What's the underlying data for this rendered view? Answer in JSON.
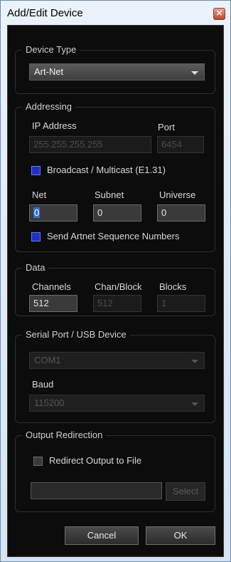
{
  "window": {
    "title": "Add/Edit Device",
    "close_glyph": "✕"
  },
  "device_type": {
    "legend": "Device Type",
    "selected": "Art-Net"
  },
  "addressing": {
    "legend": "Addressing",
    "ip_label": "IP Address",
    "ip_value": "255.255.255.255",
    "port_label": "Port",
    "port_value": "6454",
    "broadcast_label": "Broadcast / Multicast (E1.31)",
    "broadcast_checked": true,
    "net_label": "Net",
    "net_value": "0",
    "subnet_label": "Subnet",
    "subnet_value": "0",
    "universe_label": "Universe",
    "universe_value": "0",
    "sequence_label": "Send Artnet Sequence Numbers",
    "sequence_checked": true
  },
  "data_group": {
    "legend": "Data",
    "channels_label": "Channels",
    "channels_value": "512",
    "chan_block_label": "Chan/Block",
    "chan_block_value": "512",
    "blocks_label": "Blocks",
    "blocks_value": "1"
  },
  "serial": {
    "legend": "Serial Port / USB Device",
    "port_selected": "COM1",
    "baud_label": "Baud",
    "baud_selected": "115200"
  },
  "output": {
    "legend": "Output Redirection",
    "redirect_label": "Redirect Output to File",
    "redirect_checked": false,
    "file_path": "",
    "select_label": "Select"
  },
  "buttons": {
    "cancel": "Cancel",
    "ok": "OK"
  }
}
